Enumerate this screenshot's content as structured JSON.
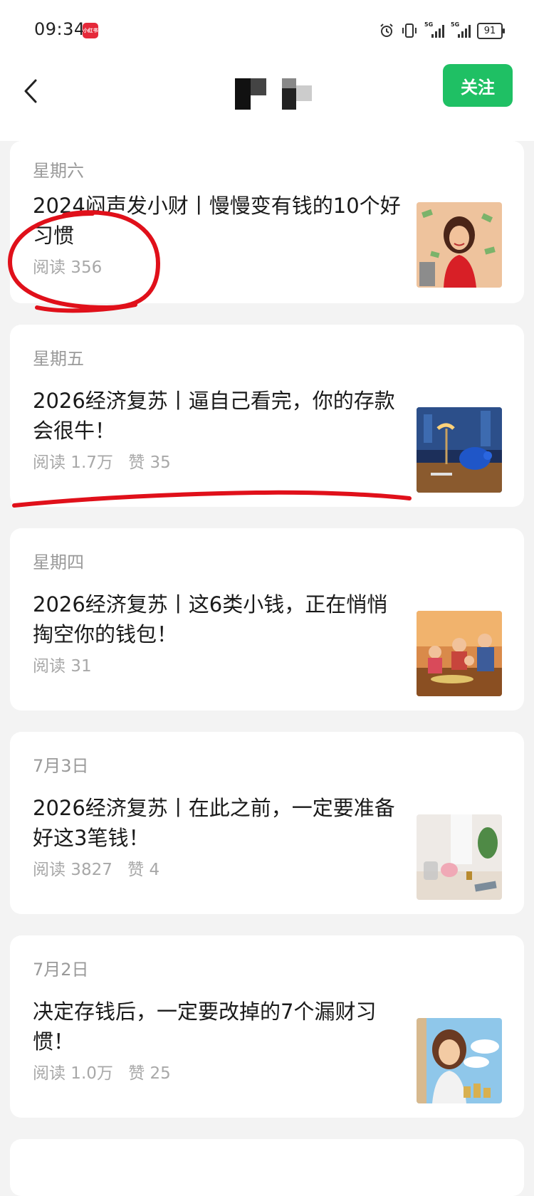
{
  "status_bar": {
    "time": "09:34",
    "notification_badge": "小红书",
    "network_1": "5G",
    "network_2": "5G",
    "battery": "91"
  },
  "header": {
    "back_icon": "chevron-left-icon",
    "follow_label": "关注",
    "accent": "#1fc064"
  },
  "articles": [
    {
      "date": "星期六",
      "title": "2024闷声发小财丨慢慢变有钱的10个好习惯",
      "reads": "阅读 356",
      "likes": ""
    },
    {
      "date": "星期五",
      "title": "2026经济复苏丨逼自己看完，你的存款会很牛！",
      "reads": "阅读 1.7万",
      "likes": "赞 35"
    },
    {
      "date": "星期四",
      "title": "2026经济复苏丨这6类小钱，正在悄悄掏空你的钱包！",
      "reads": "阅读 31",
      "likes": ""
    },
    {
      "date": "7月3日",
      "title": "2026经济复苏丨在此之前，一定要准备好这3笔钱！",
      "reads": "阅读 3827",
      "likes": "赞 4"
    },
    {
      "date": "7月2日",
      "title": "决定存钱后，一定要改掉的7个漏财习惯！",
      "reads": "阅读 1.0万",
      "likes": "赞 25"
    }
  ],
  "annotation_color": "#e0101a"
}
